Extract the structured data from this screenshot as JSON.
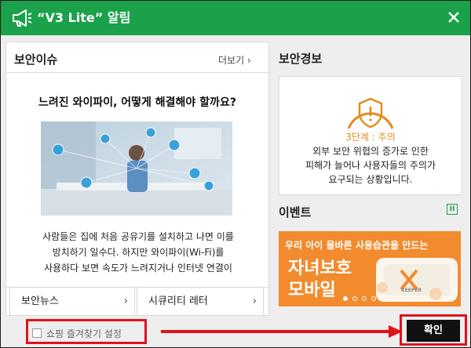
{
  "window": {
    "title": "“V3 Lite” 알림",
    "close_icon": "close-icon",
    "title_icon": "megaphone-icon",
    "accent_color": "#1aa14a"
  },
  "security_issue": {
    "heading": "보안이슈",
    "more_label": "더보기 ›",
    "headline": "느려진 와이파이, 어떻게 해결해야 할까요?",
    "body_lines": [
      "사람들은 집에 처음 공유기를 설치하고 나면 이를",
      "방치하기 일수다. 하지만 와이파이(Wi-Fi)를",
      "사용하다 보면 속도가 느려지거나 인터넷 연결이"
    ],
    "tabs": [
      {
        "label": "보안뉴스",
        "chevron": "›"
      },
      {
        "label": "시큐리티 레터",
        "chevron": "›"
      }
    ]
  },
  "security_alert": {
    "heading": "보안경보",
    "level": "3단계 : 주의",
    "level_color": "#e58a17",
    "desc_lines": [
      "외부 보안 위협의 증가로 인한",
      "피해가 늘어나 사용자들의 주의가",
      "요구되는 상황입니다."
    ]
  },
  "event": {
    "heading": "이벤트",
    "menu_icon": "pause-icon",
    "banner": {
      "line1": "우리 아이 올바른 사용습관을 만드는",
      "line2": "자녀보호",
      "line3": "모바일",
      "logo_text": "KEEPER",
      "color": "#f18b2d"
    }
  },
  "footer": {
    "checkbox_label": "쇼핑 즐겨찾기 설정",
    "checkbox_checked": false,
    "ok_label": "확인",
    "highlight_color": "#e0121b"
  }
}
